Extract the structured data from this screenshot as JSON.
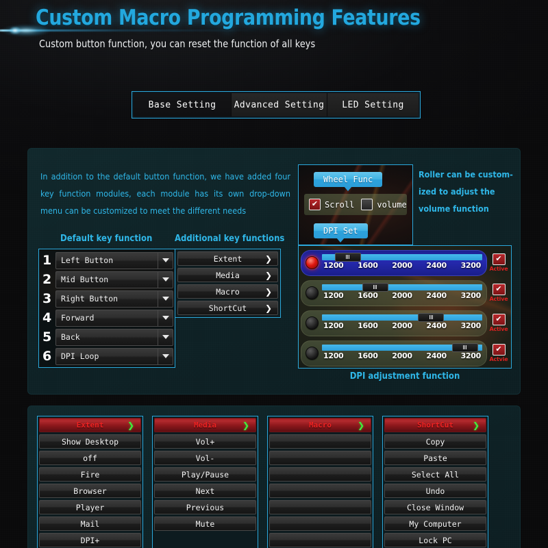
{
  "header": {
    "title": "Custom Macro Programming Features",
    "subtitle": "Custom button function, you can reset the function of all keys"
  },
  "tabs": [
    {
      "label": "Base Setting",
      "active": true
    },
    {
      "label": "Advanced Setting",
      "active": false
    },
    {
      "label": "LED Setting",
      "active": false
    }
  ],
  "main": {
    "intro": "In addition to the default button function, we have added four key function modules, each module has its own drop-down menu can be customized to meet the different needs",
    "default_key_heading": "Default key function",
    "additional_key_heading": "Additional key functions",
    "default_keys": [
      {
        "num": "1",
        "value": "Left Button"
      },
      {
        "num": "2",
        "value": "Mid Button"
      },
      {
        "num": "3",
        "value": "Right Button"
      },
      {
        "num": "4",
        "value": "Forward"
      },
      {
        "num": "5",
        "value": "Back"
      },
      {
        "num": "6",
        "value": "DPI Loop"
      }
    ],
    "additional_keys": [
      {
        "label": "Extent",
        "arrow": "❯"
      },
      {
        "label": "Media",
        "arrow": "❯"
      },
      {
        "label": "Macro",
        "arrow": "❯"
      },
      {
        "label": "ShortCut",
        "arrow": "❯"
      }
    ],
    "wheel": {
      "callout": "Wheel Func",
      "scroll_label": "Scroll",
      "scroll_checked": true,
      "volume_label": "volume",
      "volume_checked": false,
      "dpi_callout": "DPI Set"
    },
    "roller_text": "Roller can be custom-ized to adjust the volume function",
    "dpi_caption": "DPI adjustment function",
    "dpi_ticks": [
      "1200",
      "1600",
      "2000",
      "2400",
      "3200"
    ],
    "dpi_rows": [
      {
        "selected": true,
        "active_label": "Active",
        "value": "1200",
        "thumb_pct": 8
      },
      {
        "selected": false,
        "active_label": "Active",
        "value": "1600",
        "thumb_pct": 25
      },
      {
        "selected": false,
        "active_label": "Active",
        "value": "2400",
        "thumb_pct": 60
      },
      {
        "selected": false,
        "active_label": "Actvie",
        "value": "3200",
        "thumb_pct": 81
      }
    ]
  },
  "menus": [
    {
      "title": "Extent",
      "arrow": "❯",
      "items": [
        "Show Desktop",
        "off",
        "Fire",
        "Browser",
        "Player",
        "Mail",
        "DPI+"
      ]
    },
    {
      "title": "Media",
      "arrow": "❯",
      "items": [
        "Vol+",
        "Vol-",
        "Play/Pause",
        "Next",
        "Previous",
        "Mute"
      ]
    },
    {
      "title": "Macro",
      "arrow": "❯",
      "items": [
        "",
        "",
        "",
        "",
        "",
        "",
        ""
      ]
    },
    {
      "title": "ShortCut",
      "arrow": "❯",
      "items": [
        "Copy",
        "Paste",
        "Select All",
        "Undo",
        "Close Window",
        "My Computer",
        "Lock PC"
      ]
    }
  ],
  "colors": {
    "accent": "#2fb7e8",
    "tab_border": "#2ba9dd",
    "menu_head_text": "#ee2222",
    "menu_head_arrow": "#3ef03e",
    "active_red": "#e02020"
  }
}
